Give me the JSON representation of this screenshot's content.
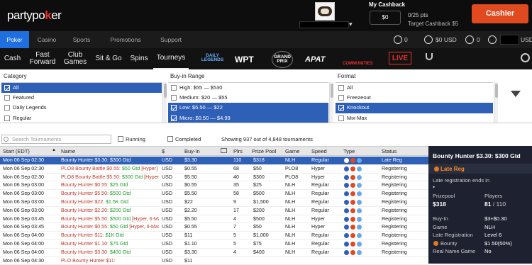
{
  "header": {
    "logo_prefix": "party",
    "logo_mid": "po",
    "logo_k": "k",
    "logo_suffix": "er",
    "cashback_title": "My Cashback",
    "cashback_amount": "$0",
    "cashback_points": "0/25 pts",
    "cashback_target": "Target Cashback $5",
    "cashier_label": "Cashier"
  },
  "nav": {
    "tabs": [
      "Poker",
      "Casino",
      "Sports",
      "Promotions",
      "Support"
    ],
    "active": "Poker",
    "stat1": "0",
    "stat2": "$0 USD",
    "stat3": "0",
    "currency": "USD"
  },
  "subnav": {
    "items": [
      "Cash",
      "Fast Forward",
      "Club Games",
      "Sit & Go",
      "Spins",
      "Tourneys"
    ],
    "active": "Tourneys",
    "brands": [
      "DAILY LEGENDS",
      "WPT",
      "GRAND PRIX",
      "APAT",
      "COMMUNITIES",
      "LIVE"
    ]
  },
  "filters": {
    "category": {
      "title": "Category",
      "items": [
        {
          "label": "All",
          "selected": true
        },
        {
          "label": "Featured",
          "selected": false
        },
        {
          "label": "Daily Legends",
          "selected": false
        },
        {
          "label": "Regular",
          "selected": false
        }
      ]
    },
    "buyin": {
      "title": "Buy-in Range",
      "items": [
        {
          "label": "High: $55 — $530",
          "selected": false
        },
        {
          "label": "Medium: $20 — $55",
          "selected": false
        },
        {
          "label": "Low: $5.50 — $22",
          "selected": true
        },
        {
          "label": "Micro: $0.50 — $4.99",
          "selected": true
        }
      ]
    },
    "format": {
      "title": "Format",
      "items": [
        {
          "label": "All",
          "selected": false
        },
        {
          "label": "Freezeout",
          "selected": false
        },
        {
          "label": "Knockout",
          "selected": true
        },
        {
          "label": "Mix-Max",
          "selected": false
        }
      ]
    }
  },
  "toolbar": {
    "search_placeholder": "Search Tournaments",
    "running_label": "Running",
    "completed_label": "Completed",
    "showing": "Showing 937 out of 4,848 tournaments"
  },
  "table": {
    "columns": [
      "Start (EDT)",
      "Name",
      "$",
      "Buy-In",
      "Plrs",
      "Prize Pool",
      "Game",
      "Speed",
      "Type",
      "Status"
    ],
    "rows": [
      {
        "start": "Mon 06 Sep 02:30",
        "name": "Bounty Hunter $3.30: $300 Gtd",
        "gtd": "",
        "cur": "USD",
        "buyin": "$3.30",
        "plrs": "110",
        "prize": "$318",
        "game": "NLH",
        "speed": "Regular",
        "status": "Late Reg",
        "selected": true
      },
      {
        "start": "Mon 06 Sep 02:30",
        "name": "PLO8 Bounty Battle $0.55: ",
        "gtd": "$50 Gtd",
        "extra": " [Hyper]",
        "cur": "USD",
        "buyin": "$0.55",
        "plrs": "68",
        "prize": "$50",
        "game": "PLO8",
        "speed": "Hyper",
        "status": "Registering"
      },
      {
        "start": "Mon 06 Sep 02:30",
        "name": "PLO8 Bounty Battle $5.50: ",
        "gtd": "$300 Gtd",
        "extra": " [Hyper]",
        "cur": "USD",
        "buyin": "$5.50",
        "plrs": "40",
        "prize": "$300",
        "game": "PLO8",
        "speed": "Hyper",
        "status": "Registering"
      },
      {
        "start": "Mon 06 Sep 03:00",
        "name": "Bounty Hunter $0.55: ",
        "gtd": "$25 Gtd",
        "cur": "USD",
        "buyin": "$0.55",
        "plrs": "35",
        "prize": "$25",
        "game": "NLH",
        "speed": "Regular",
        "status": "Registering"
      },
      {
        "start": "Mon 06 Sep 03:00",
        "name": "Bounty Hunter $5.50: ",
        "gtd": "$500 Gtd",
        "cur": "USD",
        "buyin": "$5.50",
        "plrs": "58",
        "prize": "$500",
        "game": "NLH",
        "speed": "Regular",
        "status": "Registering"
      },
      {
        "start": "Mon 06 Sep 03:00",
        "name": "Bounty Hunter $22: ",
        "gtd": "$1.5K Gtd",
        "cur": "USD",
        "buyin": "$22",
        "plrs": "9",
        "prize": "$1,500",
        "game": "NLH",
        "speed": "Regular",
        "status": "Registering"
      },
      {
        "start": "Mon 06 Sep 03:00",
        "name": "Bounty Hunter $2.20: ",
        "gtd": "$200 Gtd",
        "cur": "USD",
        "buyin": "$2.20",
        "plrs": "17",
        "prize": "$200",
        "game": "NLH",
        "speed": "Regular",
        "status": "Registering"
      },
      {
        "start": "Mon 06 Sep 03:45",
        "name": "Bounty Hunter $5.50: ",
        "gtd": "$500 Gtd",
        "extra": " [Hyper, 6-Max]",
        "cur": "USD",
        "buyin": "$5.50",
        "plrs": "4",
        "prize": "$500",
        "game": "NLH",
        "speed": "Hyper",
        "status": "Registering"
      },
      {
        "start": "Mon 06 Sep 03:45",
        "name": "Bounty Hunter $0.55: ",
        "gtd": "$50 Gtd",
        "extra": " [Hyper, 6-Max]",
        "cur": "USD",
        "buyin": "$0.55",
        "plrs": "7",
        "prize": "$50",
        "game": "NLH",
        "speed": "Hyper",
        "status": "Registering"
      },
      {
        "start": "Mon 06 Sep 04:00",
        "name": "Bounty Hunter $11: ",
        "gtd": "$1K Gtd",
        "cur": "USD",
        "buyin": "$11",
        "plrs": "5",
        "prize": "$1,000",
        "game": "NLH",
        "speed": "Regular",
        "status": "Registering"
      },
      {
        "start": "Mon 06 Sep 04:00",
        "name": "Bounty Hunter $1.10: ",
        "gtd": "$75 Gtd",
        "cur": "USD",
        "buyin": "$1.10",
        "plrs": "5",
        "prize": "$75",
        "game": "NLH",
        "speed": "Regular",
        "status": "Registering"
      },
      {
        "start": "Mon 06 Sep 04:00",
        "name": "Bounty Hunter $3.30: ",
        "gtd": "$400 Gtd",
        "cur": "USD",
        "buyin": "$3.30",
        "plrs": "4",
        "prize": "$400",
        "game": "NLH",
        "speed": "Regular",
        "status": "Registering"
      },
      {
        "start": "Mon 06 Sep 04:30",
        "name": "PLO Bounty Hunter $11: ",
        "gtd": "",
        "cur": "USD",
        "buyin": "$11",
        "plrs": "",
        "prize": "",
        "game": "",
        "speed": "",
        "status": ""
      }
    ]
  },
  "panel": {
    "title": "Bounty Hunter $3.30: $300 Gtd",
    "status": "Late Reg",
    "late_label": "Late registration ends in",
    "prizepool_label": "Prizepool",
    "prizepool": "$318",
    "players_label": "Players",
    "players": "81",
    "players_of": " / 110",
    "details": [
      {
        "label": "Buy-In",
        "value": "$3+$0.30"
      },
      {
        "label": "Game",
        "value": "NLH"
      },
      {
        "label": "Late Registration",
        "value": "Level 6"
      },
      {
        "label": "Bounty",
        "value": "$1.50(50%)"
      },
      {
        "label": "Real Name Game",
        "value": "No"
      }
    ]
  },
  "colors": {
    "accent": "#2f60b8",
    "cashier": "#e04a1e",
    "header_bg": "#0d0d0d",
    "panel_bg": "#1e2230",
    "late_reg": "#ff8a1e",
    "gtd_green": "#1a9a2a",
    "name_red": "#c0392b"
  }
}
